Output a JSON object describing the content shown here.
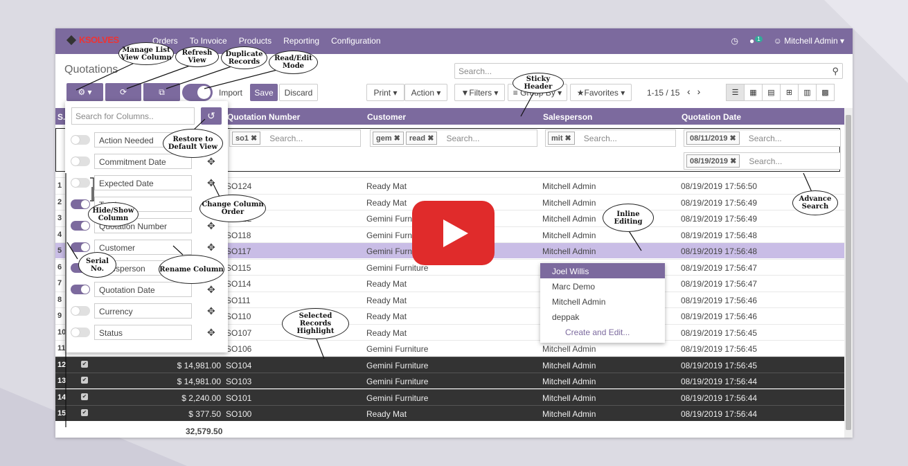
{
  "app": {
    "logo": "KSOLVES",
    "menu": [
      "Orders",
      "To Invoice",
      "Products",
      "Reporting",
      "Configuration"
    ],
    "user": "Mitchell Admin",
    "chat_count": "1",
    "accent_color": "#7c6a9e"
  },
  "control_panel": {
    "title": "Quotations",
    "search_placeholder": "Search...",
    "buttons": {
      "import": "Import",
      "save": "Save",
      "discard": "Discard",
      "print": "Print",
      "action": "Action",
      "filters": "Filters",
      "groupby": "Group By",
      "favorites": "Favorites"
    },
    "pager": "1-15 / 15"
  },
  "columns_panel": {
    "search_placeholder": "Search for Columns..",
    "columns": [
      {
        "name": "Action Needed",
        "on": false
      },
      {
        "name": "Commitment Date",
        "on": false
      },
      {
        "name": "Expected Date",
        "on": false
      },
      {
        "name": "Total",
        "on": true
      },
      {
        "name": "Quotation Number",
        "on": true
      },
      {
        "name": "Customer",
        "on": true
      },
      {
        "name": "Salesperson",
        "on": true
      },
      {
        "name": "Quotation Date",
        "on": true
      },
      {
        "name": "Currency",
        "on": false
      },
      {
        "name": "Status",
        "on": false
      }
    ]
  },
  "table": {
    "headers": {
      "serial": "S.",
      "number": "Quotation Number",
      "customer": "Customer",
      "salesperson": "Salesperson",
      "date": "Quotation Date"
    },
    "filters": {
      "number_chips": [
        "so1"
      ],
      "customer_chips": [
        "gem",
        "read"
      ],
      "salesperson_chips": [
        "mit"
      ],
      "date_chips": [
        "08/11/2019",
        "08/19/2019"
      ],
      "placeholder": "Search..."
    },
    "rows": [
      {
        "n": "1",
        "total": "",
        "number": "SO124",
        "customer": "Ready Mat",
        "sales": "Mitchell Admin",
        "date": "08/19/2019 17:56:50",
        "state": ""
      },
      {
        "n": "2",
        "total": "",
        "number": "SO123",
        "customer": "Ready Mat",
        "sales": "Mitchell Admin",
        "date": "08/19/2019 17:56:49",
        "state": ""
      },
      {
        "n": "3",
        "total": "",
        "number": "SO122",
        "customer": "Gemini Furniture",
        "sales": "Mitchell Admin",
        "date": "08/19/2019 17:56:49",
        "state": ""
      },
      {
        "n": "4",
        "total": "",
        "number": "SO118",
        "customer": "Gemini Furniture",
        "sales": "Mitchell Admin",
        "date": "08/19/2019 17:56:48",
        "state": ""
      },
      {
        "n": "5",
        "total": "",
        "number": "SO117",
        "customer": "Gemini Furni",
        "sales": "Mitchell Admin",
        "date": "08/19/2019 17:56:48",
        "state": "sel"
      },
      {
        "n": "6",
        "total": "",
        "number": "SO115",
        "customer": "Gemini Furniture",
        "sales": "",
        "date": "08/19/2019 17:56:47",
        "state": ""
      },
      {
        "n": "7",
        "total": "",
        "number": "SO114",
        "customer": "Ready Mat",
        "sales": "",
        "date": "08/19/2019 17:56:47",
        "state": ""
      },
      {
        "n": "8",
        "total": "",
        "number": "SO111",
        "customer": "Ready Mat",
        "sales": "",
        "date": "08/19/2019 17:56:46",
        "state": ""
      },
      {
        "n": "9",
        "total": "",
        "number": "SO110",
        "customer": "Ready Mat",
        "sales": "",
        "date": "08/19/2019 17:56:46",
        "state": ""
      },
      {
        "n": "10",
        "total": "",
        "number": "SO107",
        "customer": "Ready Mat",
        "sales": "",
        "date": "08/19/2019 17:56:45",
        "state": ""
      },
      {
        "n": "11",
        "total": "",
        "number": "SO106",
        "customer": "Gemini Furniture",
        "sales": "Mitchell Admin",
        "date": "08/19/2019 17:56:45",
        "state": ""
      },
      {
        "n": "12",
        "total": "$ 14,981.00",
        "number": "SO104",
        "customer": "Gemini Furniture",
        "sales": "Mitchell Admin",
        "date": "08/19/2019 17:56:45",
        "state": "dark"
      },
      {
        "n": "13",
        "total": "$ 14,981.00",
        "number": "SO103",
        "customer": "Gemini Furniture",
        "sales": "Mitchell Admin",
        "date": "08/19/2019 17:56:44",
        "state": "dark"
      },
      {
        "n": "14",
        "total": "$ 2,240.00",
        "number": "SO101",
        "customer": "Gemini Furniture",
        "sales": "Mitchell Admin",
        "date": "08/19/2019 17:56:44",
        "state": "dark"
      },
      {
        "n": "15",
        "total": "$ 377.50",
        "number": "SO100",
        "customer": "Ready Mat",
        "sales": "Mitchell Admin",
        "date": "08/19/2019 17:56:44",
        "state": "dark"
      }
    ],
    "grand_total": "32,579.50"
  },
  "dropdown": {
    "options": [
      "Joel Willis",
      "Marc Demo",
      "Mitchell Admin",
      "deppak"
    ],
    "create": "Create and Edit..."
  },
  "callouts": {
    "manage": "Manage List View Column",
    "refresh": "Refresh View",
    "duplicate": "Duplicate Records",
    "readedit": "Read/Edit Mode",
    "sticky": "Sticky Header",
    "restore": "Restore to Default View",
    "change_order": "Change Column Order",
    "hideshow": "Hide/Show Column",
    "serial": "Serial No.",
    "rename": "Rename Column",
    "inline": "Inline Editing",
    "advance": "Advance Search",
    "selected": "Selected Records Highlight"
  }
}
